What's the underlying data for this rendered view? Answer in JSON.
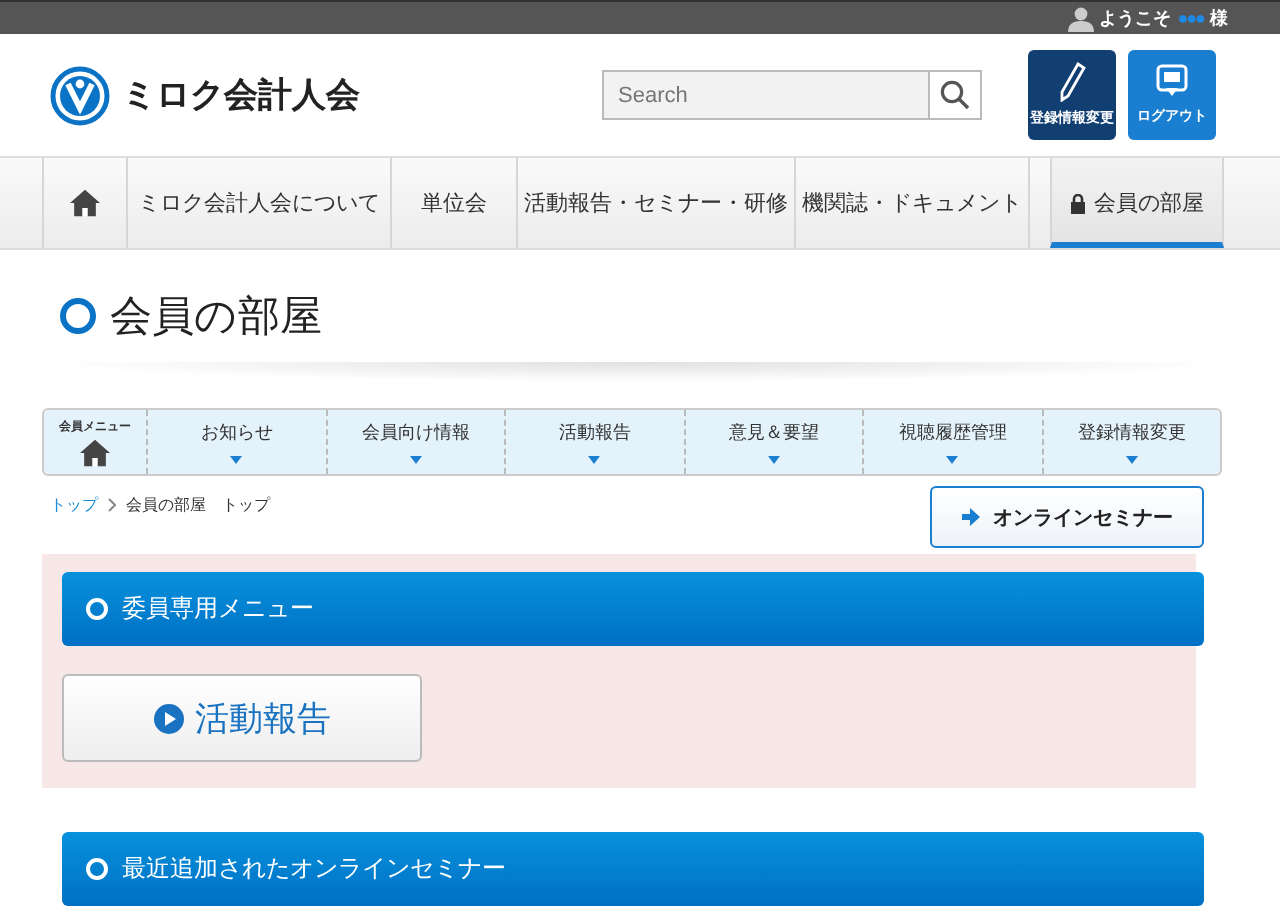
{
  "header": {
    "welcome": "ようこそ",
    "user_name": "●●●",
    "honorific": "様",
    "site_name": "ミロク会計人会",
    "search": {
      "placeholder": "Search"
    },
    "buttons": [
      {
        "label": "登録情報変更",
        "kind": "edit"
      },
      {
        "label": "ログアウト",
        "kind": "logout"
      }
    ]
  },
  "nav": [
    {
      "kind": "home",
      "selected": false
    },
    {
      "kind": "text",
      "label": "ミロク会計人会について",
      "selected": false
    },
    {
      "kind": "text",
      "label": "単位会",
      "selected": false
    },
    {
      "kind": "text",
      "label": "活動報告・セミナー・研修",
      "selected": false
    },
    {
      "kind": "text",
      "label": "機関誌・ドキュメント",
      "selected": false
    },
    {
      "kind": "locked",
      "label": "会員の部屋",
      "selected": true
    }
  ],
  "page_title": "会員の部屋",
  "member_menu": {
    "label": "会員メニュー",
    "items": [
      "お知らせ",
      "会員向け情報",
      "活動報告",
      "意見＆要望",
      "視聴履歴管理",
      "登録情報変更"
    ]
  },
  "breadcrumb": [
    {
      "kind": "link",
      "label": "トップ"
    },
    {
      "kind": "current",
      "label": "会員の部屋　トップ"
    }
  ],
  "online_seminar_button": "オンラインセミナー",
  "sections": [
    {
      "title": "委員専用メニュー",
      "highlighted": true,
      "buttons": [
        "活動報告"
      ]
    },
    {
      "title": "最近追加されたオンラインセミナー",
      "highlighted": false
    }
  ]
}
